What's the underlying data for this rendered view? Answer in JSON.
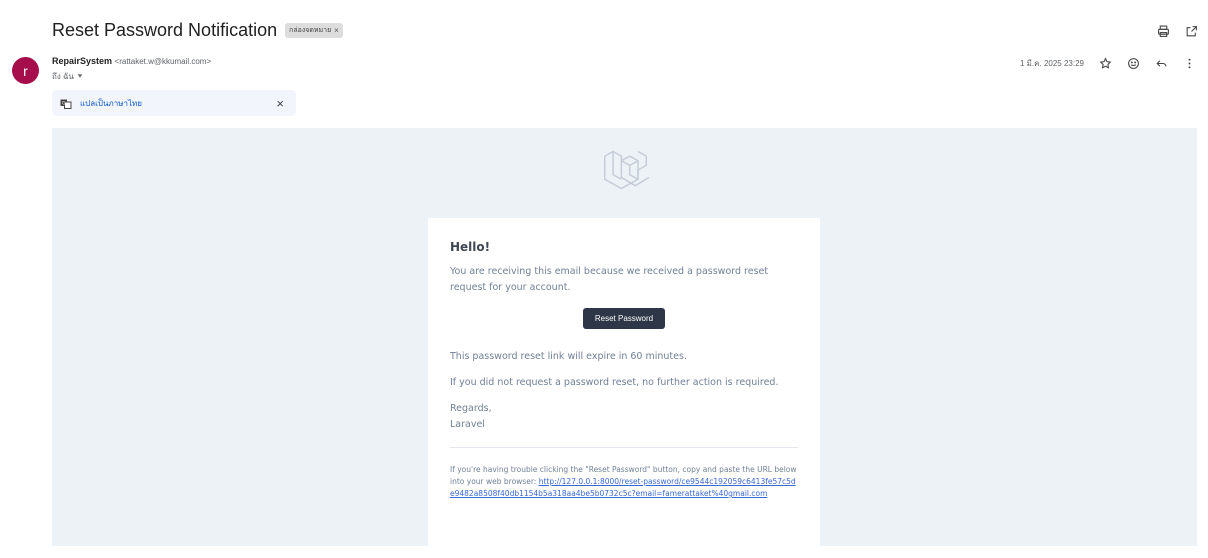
{
  "email": {
    "subject": "Reset Password Notification",
    "label_chip": "กล่องจดหมาย",
    "label_chip_close": "×",
    "sender_name": "RepairSystem",
    "sender_email": "<rattaket.w@kkumail.com>",
    "to_line": "ถึง ฉัน",
    "date": "1 มี.ค. 2025 23:29",
    "avatar_letter": "r"
  },
  "translate_bar": {
    "link_text": "แปลเป็นภาษาไทย",
    "close": "×"
  },
  "body": {
    "greeting": "Hello!",
    "intro": "You are receiving this email because we received a password reset request for your account.",
    "button_label": "Reset Password",
    "expire_text": "This password reset link will expire in 60 minutes.",
    "no_action_text": "If you did not request a password reset, no further action is required.",
    "regards": "Regards,",
    "signature": "Laravel",
    "subcopy_text": "If you're having trouble clicking the \"Reset Password\" button, copy and paste the URL below into your web browser:",
    "reset_url": "http://127.0.0.1:8000/reset-password/ce9544c192059c6413fe57c5de9482a8508f40db1154b5a318aa4be5b0732c5c?email=famerattaket%40gmail.com"
  },
  "icons": {
    "print": "printer-icon",
    "open_new_window": "open-in-new-window-icon",
    "star": "star-icon",
    "emoji": "emoji-icon",
    "reply": "reply-icon",
    "more": "more-vertical-icon",
    "translate": "translate-icon",
    "dropdown": "chevron-down-icon",
    "laravel_logo": "laravel-logo-icon"
  },
  "colors": {
    "avatar_bg": "#a50e4b",
    "canvas_bg": "#edf2f7",
    "button_bg": "#2d3748",
    "link": "#3869d4",
    "translate_link": "#0b57d0"
  }
}
